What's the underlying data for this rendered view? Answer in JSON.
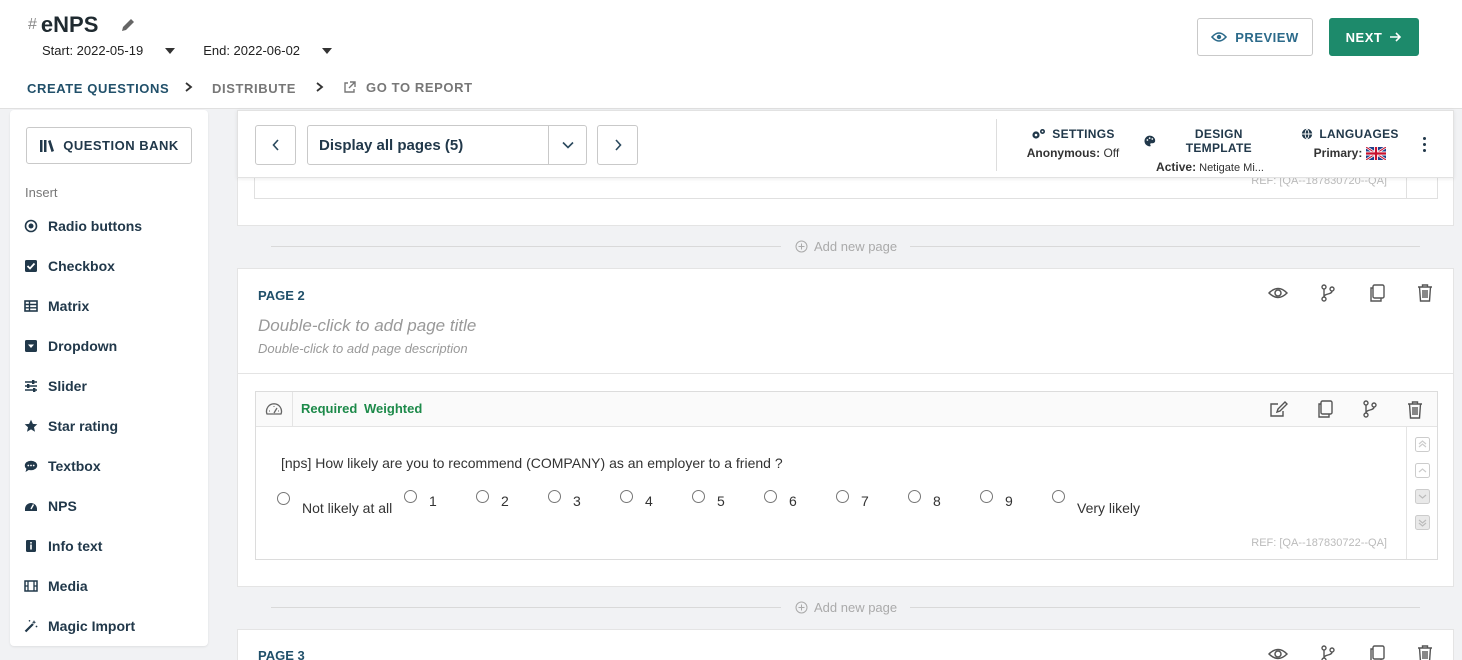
{
  "header": {
    "hash": "#",
    "title": "eNPS",
    "start_label": "Start: 2022-05-19",
    "end_label": "End: 2022-06-02",
    "preview_label": "PREVIEW",
    "next_label": "NEXT"
  },
  "tabs": [
    {
      "label": "CREATE QUESTIONS",
      "active": true
    },
    {
      "label": "DISTRIBUTE",
      "active": false
    },
    {
      "label": "GO TO REPORT",
      "active": false
    }
  ],
  "sidebar": {
    "question_bank_label": "QUESTION BANK",
    "insert_label": "Insert",
    "items": [
      {
        "label": "Radio buttons",
        "icon": "radio-icon"
      },
      {
        "label": "Checkbox",
        "icon": "checkbox-icon"
      },
      {
        "label": "Matrix",
        "icon": "matrix-icon"
      },
      {
        "label": "Dropdown",
        "icon": "dropdown-icon"
      },
      {
        "label": "Slider",
        "icon": "slider-icon"
      },
      {
        "label": "Star rating",
        "icon": "star-icon"
      },
      {
        "label": "Textbox",
        "icon": "comment-icon"
      },
      {
        "label": "NPS",
        "icon": "gauge-icon"
      },
      {
        "label": "Info text",
        "icon": "info-icon"
      },
      {
        "label": "Media",
        "icon": "film-icon"
      },
      {
        "label": "Magic Import",
        "icon": "magic-wand-icon"
      }
    ]
  },
  "toolbar": {
    "page_select": "Display all pages (5)",
    "settings_label": "SETTINGS",
    "settings_sub_key": "Anonymous:",
    "settings_sub_val": "Off",
    "design_label": "DESIGN TEMPLATE",
    "design_sub_key": "Active:",
    "design_sub_val": "Netigate Mi...",
    "languages_label": "LANGUAGES",
    "languages_sub_key": "Primary:"
  },
  "page1": {
    "ref": "REF: [QA--187830720--QA]"
  },
  "add_page_label": "Add new page",
  "page2": {
    "label": "PAGE 2",
    "title_placeholder": "Double-click to add page title",
    "desc_placeholder": "Double-click to add page description",
    "question": {
      "required": "Required",
      "weighted": "Weighted",
      "text": "[nps] How likely are you to recommend (COMPANY) as an employer to a friend ?",
      "options": [
        "Not likely at all",
        "1",
        "2",
        "3",
        "4",
        "5",
        "6",
        "7",
        "8",
        "9",
        "Very likely"
      ],
      "ref": "REF: [QA--187830722--QA]"
    }
  },
  "page3": {
    "label": "PAGE 3"
  },
  "colors": {
    "primary": "#1d8a6b",
    "accent": "#21506a",
    "green_text": "#1d8a4a"
  }
}
